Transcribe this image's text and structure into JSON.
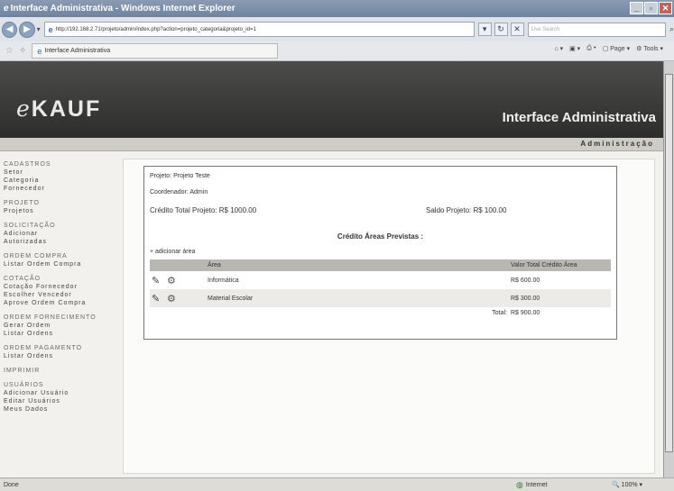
{
  "window": {
    "title": "Interface Administrativa - Windows Internet Explorer"
  },
  "address": {
    "url": "http://192.168.2.71/projeto/admin/index.php?action=projeto_categoria&projeto_id=1",
    "search_placeholder": "Live Search"
  },
  "tabbar": {
    "tab_title": "Interface Administrativa",
    "page_label": "Page",
    "tools_label": "Tools"
  },
  "banner": {
    "logo_e": "e",
    "logo_rest": "KAUF",
    "title": "Interface Administrativa",
    "section": "Administração"
  },
  "sidebar": {
    "sections": [
      {
        "title": "CADASTROS",
        "items": [
          "Setor",
          "Categoria",
          "Fornecedor"
        ]
      },
      {
        "title": "PROJETO",
        "items": [
          "Projetos"
        ]
      },
      {
        "title": "SOLICITAÇÃO",
        "items": [
          "Adicionar",
          "Autorizadas"
        ]
      },
      {
        "title": "ORDEM COMPRA",
        "items": [
          "Listar Ordem Compra"
        ]
      },
      {
        "title": "COTAÇÃO",
        "items": [
          "Cotação Fornecedor",
          "Escolher Vencedor",
          "Aprove Ordem Compra"
        ]
      },
      {
        "title": "ORDEM FORNECIMENTO",
        "items": [
          "Gerar Ordem",
          "Listar Ordens"
        ]
      },
      {
        "title": "ORDEM PAGAMENTO",
        "items": [
          "Listar Ordens"
        ]
      },
      {
        "title": "IMPRIMIR",
        "items": []
      },
      {
        "title": "USUÁRIOS",
        "items": [
          "Adicionar Usuário",
          "Editar Usuários",
          "Meus Dados"
        ]
      }
    ]
  },
  "content": {
    "projeto_label": "Projeto:",
    "projeto_value": "Projeto Teste",
    "coordenador_label": "Coordenador:",
    "coordenador_value": "Admin",
    "credito_total": "Crédito Total Projeto: R$ 1000.00",
    "saldo": "Saldo Projeto: R$ 100.00",
    "areas_title": "Crédito Áreas Previstas :",
    "add_area": "+ adicionar área",
    "table": {
      "col_area": "Área",
      "col_valor": "Valor Total Crédito Área",
      "rows": [
        {
          "area": "Informática",
          "valor": "R$ 600.00"
        },
        {
          "area": "Material Escolar",
          "valor": "R$ 300.00"
        }
      ],
      "total_label": "Total:",
      "total_value": "R$ 900.00"
    }
  },
  "status": {
    "text": "Done",
    "zone": "Internet",
    "zoom": "100%"
  },
  "icons": {
    "edit": "pencil-icon",
    "config": "gear-icon"
  }
}
